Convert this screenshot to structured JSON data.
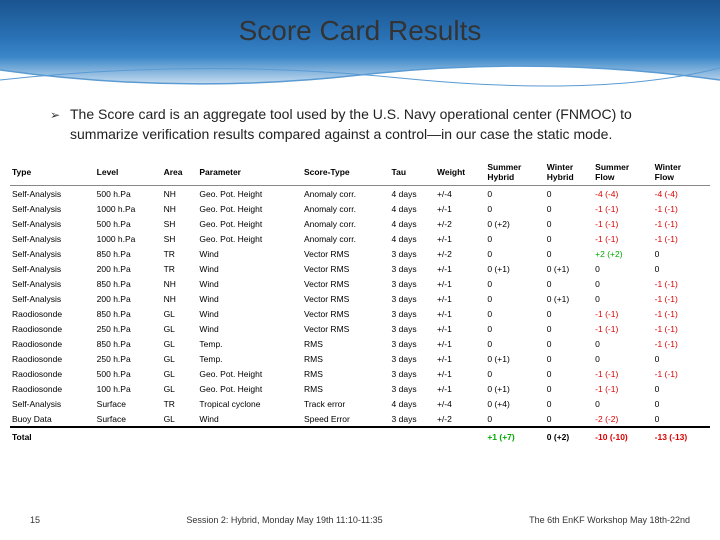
{
  "title": "Score Card Results",
  "bullet": "The Score card is an aggregate tool used by the U.S. Navy operational center (FNMOC) to summarize verification results compared against a control—in our case the static mode.",
  "headers": [
    "Type",
    "Level",
    "Area",
    "Parameter",
    "Score-Type",
    "Tau",
    "Weight",
    "Summer Hybrid",
    "Winter Hybrid",
    "Summer Flow",
    "Winter Flow"
  ],
  "rows": [
    {
      "c": [
        "Self-Analysis",
        "500 h.Pa",
        "NH",
        "Geo. Pot. Height",
        "Anomaly corr.",
        "4 days",
        "+/-4",
        "0",
        "0",
        "-4 (-4)",
        "-4 (-4)"
      ],
      "cl": [
        "",
        "",
        "",
        "",
        "",
        "",
        "",
        "",
        "",
        "red",
        "red"
      ]
    },
    {
      "c": [
        "Self-Analysis",
        "1000 h.Pa",
        "NH",
        "Geo. Pot. Height",
        "Anomaly corr.",
        "4 days",
        "+/-1",
        "0",
        "0",
        "-1 (-1)",
        "-1 (-1)"
      ],
      "cl": [
        "",
        "",
        "",
        "",
        "",
        "",
        "",
        "",
        "",
        "red",
        "red"
      ]
    },
    {
      "c": [
        "Self-Analysis",
        "500 h.Pa",
        "SH",
        "Geo. Pot. Height",
        "Anomaly corr.",
        "4 days",
        "+/-2",
        "0 (+2)",
        "0",
        "-1 (-1)",
        "-1 (-1)"
      ],
      "cl": [
        "",
        "",
        "",
        "",
        "",
        "",
        "",
        "",
        "",
        "red",
        "red"
      ]
    },
    {
      "c": [
        "Self-Analysis",
        "1000 h.Pa",
        "SH",
        "Geo. Pot. Height",
        "Anomaly corr.",
        "4 days",
        "+/-1",
        "0",
        "0",
        "-1 (-1)",
        "-1 (-1)"
      ],
      "cl": [
        "",
        "",
        "",
        "",
        "",
        "",
        "",
        "",
        "",
        "red",
        "red"
      ]
    },
    {
      "c": [
        "Self-Analysis",
        "850 h.Pa",
        "TR",
        "Wind",
        "Vector RMS",
        "3 days",
        "+/-2",
        "0",
        "0",
        "+2 (+2)",
        "0"
      ],
      "cl": [
        "",
        "",
        "",
        "",
        "",
        "",
        "",
        "",
        "",
        "green",
        ""
      ]
    },
    {
      "c": [
        "Self-Analysis",
        "200 h.Pa",
        "TR",
        "Wind",
        "Vector RMS",
        "3 days",
        "+/-1",
        "0 (+1)",
        "0 (+1)",
        "0",
        "0"
      ],
      "cl": [
        "",
        "",
        "",
        "",
        "",
        "",
        "",
        "",
        "",
        "",
        ""
      ]
    },
    {
      "c": [
        "Self-Analysis",
        "850 h.Pa",
        "NH",
        "Wind",
        "Vector RMS",
        "3 days",
        "+/-1",
        "0",
        "0",
        "0",
        "-1 (-1)"
      ],
      "cl": [
        "",
        "",
        "",
        "",
        "",
        "",
        "",
        "",
        "",
        "",
        "red"
      ]
    },
    {
      "c": [
        "Self-Analysis",
        "200 h.Pa",
        "NH",
        "Wind",
        "Vector RMS",
        "3 days",
        "+/-1",
        "0",
        "0 (+1)",
        "0",
        "-1 (-1)"
      ],
      "cl": [
        "",
        "",
        "",
        "",
        "",
        "",
        "",
        "",
        "",
        "",
        "red"
      ]
    },
    {
      "c": [
        "Raodiosonde",
        "850 h.Pa",
        "GL",
        "Wind",
        "Vector RMS",
        "3 days",
        "+/-1",
        "0",
        "0",
        "-1 (-1)",
        "-1 (-1)"
      ],
      "cl": [
        "",
        "",
        "",
        "",
        "",
        "",
        "",
        "",
        "",
        "red",
        "red"
      ]
    },
    {
      "c": [
        "Raodiosonde",
        "250 h.Pa",
        "GL",
        "Wind",
        "Vector RMS",
        "3 days",
        "+/-1",
        "0",
        "0",
        "-1 (-1)",
        "-1 (-1)"
      ],
      "cl": [
        "",
        "",
        "",
        "",
        "",
        "",
        "",
        "",
        "",
        "red",
        "red"
      ]
    },
    {
      "c": [
        "Raodiosonde",
        "850 h.Pa",
        "GL",
        "Temp.",
        "RMS",
        "3 days",
        "+/-1",
        "0",
        "0",
        "0",
        "-1 (-1)"
      ],
      "cl": [
        "",
        "",
        "",
        "",
        "",
        "",
        "",
        "",
        "",
        "",
        "red"
      ]
    },
    {
      "c": [
        "Raodiosonde",
        "250 h.Pa",
        "GL",
        "Temp.",
        "RMS",
        "3 days",
        "+/-1",
        "0 (+1)",
        "0",
        "0",
        "0"
      ],
      "cl": [
        "",
        "",
        "",
        "",
        "",
        "",
        "",
        "",
        "",
        "",
        ""
      ]
    },
    {
      "c": [
        "Raodiosonde",
        "500 h.Pa",
        "GL",
        "Geo. Pot. Height",
        "RMS",
        "3 days",
        "+/-1",
        "0",
        "0",
        "-1 (-1)",
        "-1 (-1)"
      ],
      "cl": [
        "",
        "",
        "",
        "",
        "",
        "",
        "",
        "",
        "",
        "red",
        "red"
      ]
    },
    {
      "c": [
        "Raodiosonde",
        "100 h.Pa",
        "GL",
        "Geo. Pot. Height",
        "RMS",
        "3 days",
        "+/-1",
        "0 (+1)",
        "0",
        "-1 (-1)",
        "0"
      ],
      "cl": [
        "",
        "",
        "",
        "",
        "",
        "",
        "",
        "",
        "",
        "red",
        ""
      ]
    },
    {
      "c": [
        "Self-Analysis",
        "Surface",
        "TR",
        "Tropical cyclone",
        "Track error",
        "4 days",
        "+/-4",
        "0 (+4)",
        "0",
        "0",
        "0"
      ],
      "cl": [
        "",
        "",
        "",
        "",
        "",
        "",
        "",
        "",
        "",
        "",
        ""
      ]
    },
    {
      "c": [
        "Buoy Data",
        "Surface",
        "GL",
        "Wind",
        "Speed Error",
        "3 days",
        "+/-2",
        "0",
        "0",
        "-2 (-2)",
        "0"
      ],
      "cl": [
        "",
        "",
        "",
        "",
        "",
        "",
        "",
        "",
        "",
        "red",
        ""
      ]
    }
  ],
  "total": {
    "label": "Total",
    "a": "+1 (+7)",
    "b": "0 (+2)",
    "c": "-10 (-10)",
    "d": "-13 (-13)",
    "cl": [
      "green",
      "",
      "red",
      "red"
    ]
  },
  "footer": {
    "page": "15",
    "session": "Session 2: Hybrid, Monday May 19th 11:10-11:35",
    "workshop": "The 6th EnKF Workshop May 18th-22nd"
  }
}
